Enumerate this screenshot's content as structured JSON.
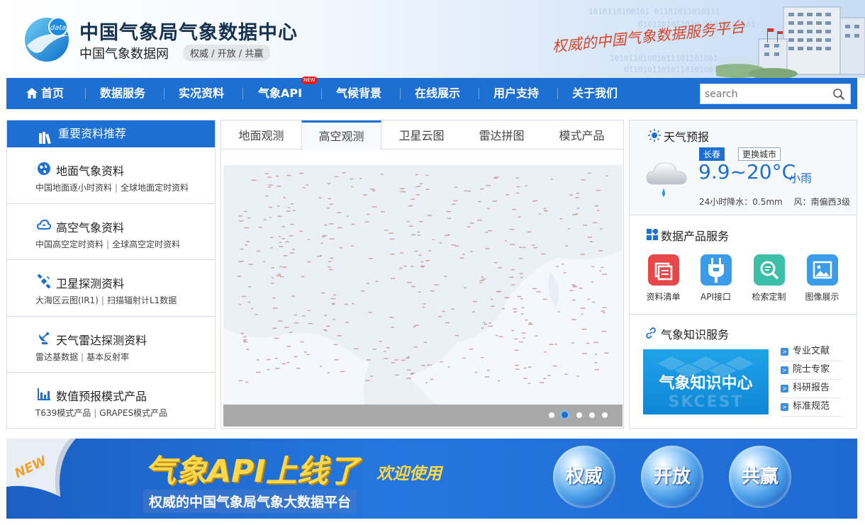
{
  "header": {
    "title": "中国气象局气象数据中心",
    "subtitle": "中国气象数据网",
    "slogan": "权威 / 开放 / 共赢",
    "script_slogan": "权威的中国气象数据服务平台",
    "logo_text": "data"
  },
  "nav": {
    "items": [
      "首页",
      "数据服务",
      "实况资料",
      "气象API",
      "气候背景",
      "在线展示",
      "用户支持",
      "关于我们"
    ],
    "new_badge": "NEW",
    "search_placeholder": "search"
  },
  "left": {
    "header": "重要资料推荐",
    "categories": [
      {
        "title": "地面气象资料",
        "links": [
          "中国地面逐小时资料",
          "全球地面定时资料"
        ],
        "icon": "globe-icon"
      },
      {
        "title": "高空气象资料",
        "links": [
          "中国高空定时资料",
          "全球高空定时资料"
        ],
        "icon": "cloud-icon"
      },
      {
        "title": "卫星探测资料",
        "links": [
          "大海区云图(IR1)",
          "扫描辐射计L1数据"
        ],
        "icon": "satellite-icon"
      },
      {
        "title": "天气雷达探测资料",
        "links": [
          "雷达基数据",
          "基本反射率"
        ],
        "icon": "radar-icon"
      },
      {
        "title": "数值预报模式产品",
        "links": [
          "T639模式产品",
          "GRAPES模式产品"
        ],
        "icon": "bar-chart-icon"
      }
    ]
  },
  "center": {
    "tabs": [
      "地面观测",
      "高空观测",
      "卫星云图",
      "雷达拼图",
      "模式产品"
    ],
    "active_tab": 1,
    "carousel_dots": 5,
    "active_dot": 1
  },
  "right": {
    "weather": {
      "title": "天气预报",
      "city": "长春",
      "change_city": "更换城市",
      "temp": "9.9~20°C",
      "condition": "小雨",
      "details": "24小时降水：0.5mm　 风：南偏西3级"
    },
    "products": {
      "title": "数据产品服务",
      "items": [
        {
          "label": "资料清单",
          "icon": "list-icon",
          "color": "#e8474a"
        },
        {
          "label": "API接口",
          "icon": "api-plug-icon",
          "color": "#3a9be8"
        },
        {
          "label": "检索定制",
          "icon": "search-icon",
          "color": "#3bbfa8"
        },
        {
          "label": "图像展示",
          "icon": "image-icon",
          "color": "#3a9be8"
        }
      ]
    },
    "knowledge": {
      "title": "气象知识服务",
      "banner_text": "气象知识中心",
      "banner_watermark": "SKCEST",
      "links": [
        "专业文献",
        "院士专家",
        "科研报告",
        "标准规范"
      ]
    }
  },
  "banner": {
    "new": "NEW",
    "title": "气象API上线了",
    "welcome": "欢迎使用",
    "subtitle": "权威的中国气象局气象大数据平台",
    "bubbles": [
      "权威",
      "开放",
      "共赢"
    ]
  },
  "colors": {
    "primary": "#1d6fd2",
    "accent_yellow": "#ffd84a",
    "accent_red": "#d8462a"
  }
}
